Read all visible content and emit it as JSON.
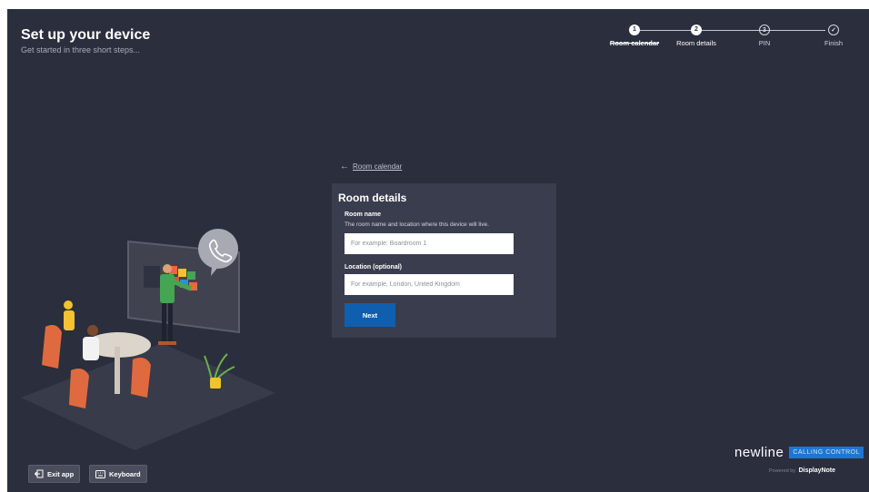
{
  "header": {
    "title": "Set up your device",
    "subtitle": "Get started in three short steps..."
  },
  "stepper": {
    "steps": [
      {
        "number": "1",
        "label": "Room calendar",
        "state": "completed"
      },
      {
        "number": "2",
        "label": "Room details",
        "state": "current"
      },
      {
        "number": "3",
        "label": "PIN",
        "state": "pending"
      },
      {
        "symbol": "✓",
        "label": "Finish",
        "state": "pending"
      }
    ]
  },
  "back_link": {
    "arrow": "←",
    "label": "Room calendar"
  },
  "form": {
    "title": "Room details",
    "room_name": {
      "label": "Room name",
      "help": "The room name and location where this device will live.",
      "placeholder": "For example: Boardroom 1",
      "value": ""
    },
    "location": {
      "label": "Location (optional)",
      "placeholder": "For example, London, United Kingdom",
      "value": ""
    },
    "next_label": "Next"
  },
  "footer": {
    "exit_label": "Exit app",
    "exit_icon": "exit-icon",
    "keyboard_label": "Keyboard",
    "keyboard_icon": "keyboard-icon"
  },
  "brand": {
    "name": "newline",
    "badge": "CALLING CONTROL",
    "powered_by": "Powered by",
    "powered_brand": "DisplayNote"
  },
  "colors": {
    "background": "#2b2e3d",
    "card": "#3a3d4d",
    "accent": "#0f5fae",
    "brand_badge": "#1c77d4"
  }
}
